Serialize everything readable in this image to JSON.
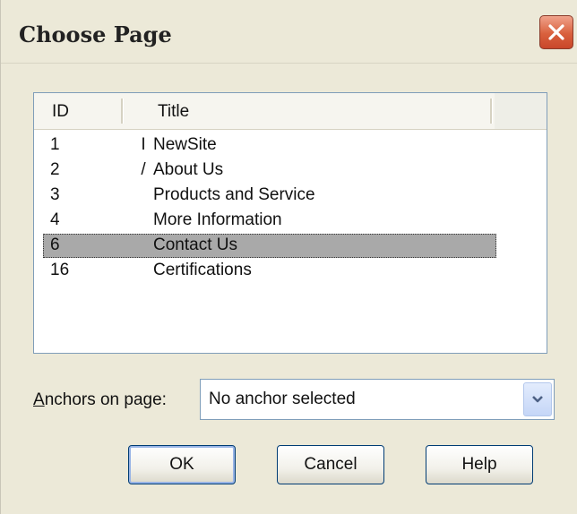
{
  "window": {
    "title": "Choose Page"
  },
  "pages": {
    "columns": {
      "id": "ID",
      "title": "Title"
    },
    "rows": [
      {
        "id": "1",
        "mark": "I",
        "title": "NewSite",
        "selected": false
      },
      {
        "id": "2",
        "mark": "/",
        "title": "About Us",
        "selected": false
      },
      {
        "id": "3",
        "mark": "",
        "title": "Products and Service",
        "selected": false
      },
      {
        "id": "4",
        "mark": "",
        "title": "More Information",
        "selected": false
      },
      {
        "id": "6",
        "mark": "",
        "title": "Contact Us",
        "selected": true
      },
      {
        "id": "16",
        "mark": "",
        "title": "Certifications",
        "selected": false
      }
    ]
  },
  "anchors": {
    "label_accel": "A",
    "label_rest": "nchors on page:",
    "selected": "No anchor selected"
  },
  "buttons": {
    "ok": "OK",
    "cancel": "Cancel",
    "help": "Help"
  },
  "icons": {
    "close": "close-icon",
    "dropdown": "chevron-down-icon"
  },
  "colors": {
    "selection": "#a9a9a9",
    "close_button": "#d9603d",
    "dialog_bg": "#ece9d8"
  }
}
